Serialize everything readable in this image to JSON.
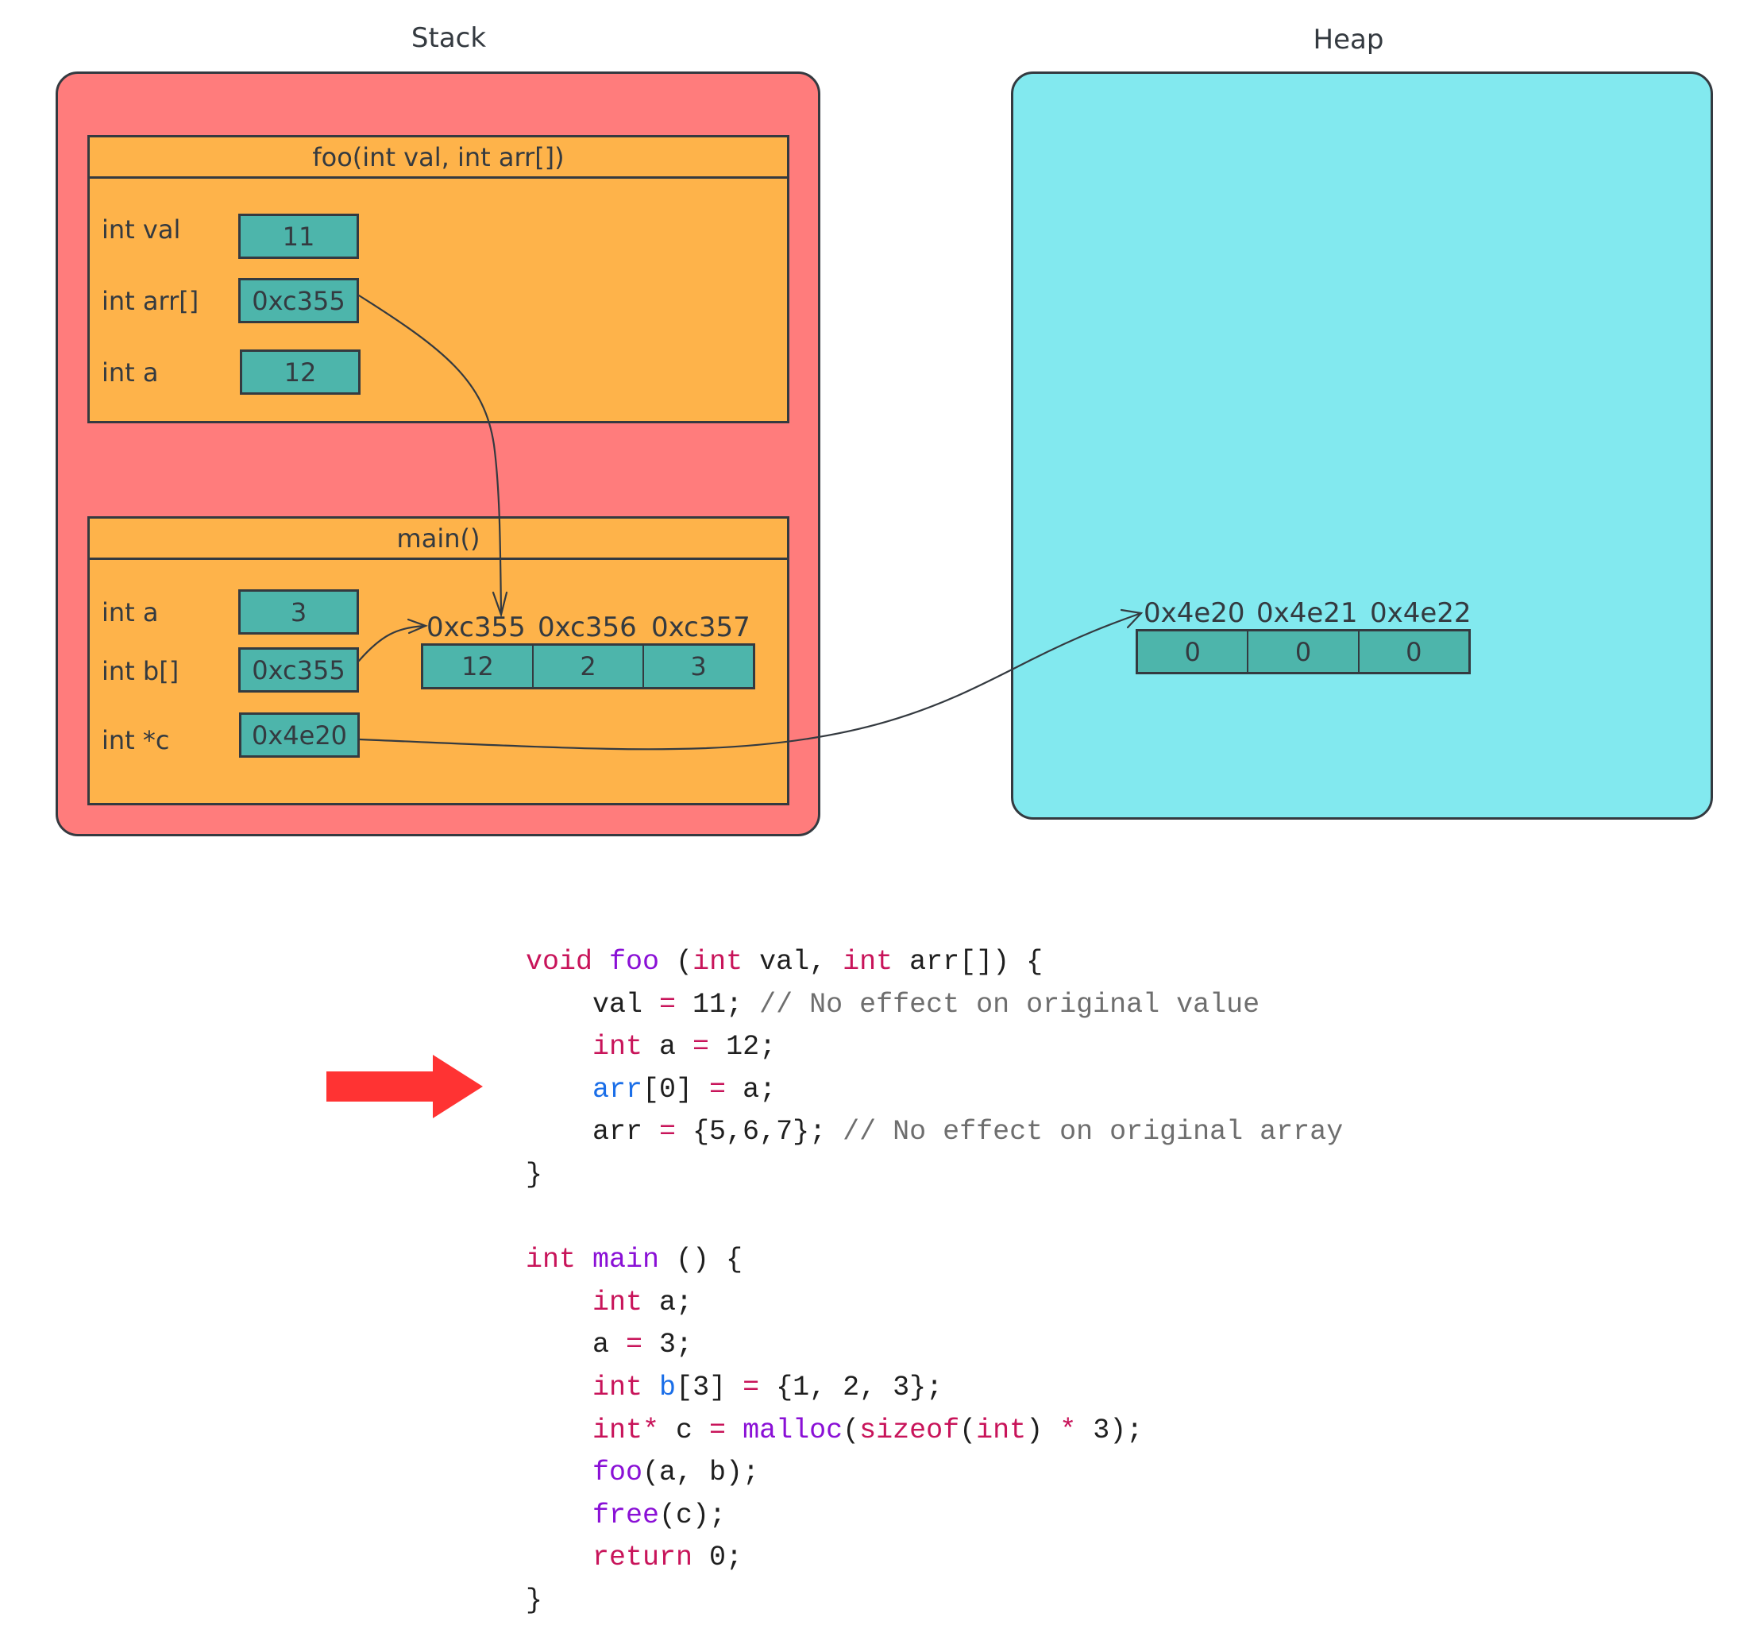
{
  "titles": {
    "stack": "Stack",
    "heap": "Heap"
  },
  "colors": {
    "stack_bg": "#ff7c7c",
    "heap_bg": "#82e9ef",
    "frame_bg": "#feb34a",
    "cell_bg": "#4db5ab",
    "stroke": "#343a40",
    "pointer_arrow": "#ff3333",
    "keyword": "#c8145a",
    "function": "#8a10d6",
    "variable_highlight": "#1a6ee8",
    "comment": "#6e6e6e"
  },
  "stack": {
    "frames": [
      {
        "header": "foo(int val, int arr[])",
        "vars": [
          {
            "label": "int val",
            "value": "11"
          },
          {
            "label": "int arr[]",
            "value": "0xc355"
          },
          {
            "label": "int a",
            "value": "12"
          }
        ]
      },
      {
        "header": "main()",
        "vars": [
          {
            "label": "int a",
            "value": "3"
          },
          {
            "label": "int b[]",
            "value": "0xc355"
          },
          {
            "label": "int *c",
            "value": "0x4e20"
          }
        ],
        "array": {
          "addresses": [
            "0xc355",
            "0xc356",
            "0xc357"
          ],
          "values": [
            "12",
            "2",
            "3"
          ]
        }
      }
    ]
  },
  "heap": {
    "array": {
      "addresses": [
        "0x4e20",
        "0x4e21",
        "0x4e22"
      ],
      "values": [
        "0",
        "0",
        "0"
      ]
    }
  },
  "pointers": [
    {
      "from": "foo.arr",
      "to": "main.b[0] (0xc355)"
    },
    {
      "from": "main.b",
      "to": "main.b[0] (0xc355)"
    },
    {
      "from": "main.c",
      "to": "heap[0] (0x4e20)"
    }
  ],
  "current_line_indicator": {
    "icon": "right-arrow-icon",
    "line_index": 3
  },
  "code": {
    "lines": [
      [
        [
          "kw",
          "void"
        ],
        [
          "t",
          " "
        ],
        [
          "fn",
          "foo"
        ],
        [
          "t",
          " ("
        ],
        [
          "kw",
          "int"
        ],
        [
          "t",
          " val, "
        ],
        [
          "kw",
          "int"
        ],
        [
          "t",
          " arr[]) {"
        ]
      ],
      [
        [
          "t",
          "    val "
        ],
        [
          "op",
          "="
        ],
        [
          "t",
          " 11; "
        ],
        [
          "cm",
          "// No effect on original value"
        ]
      ],
      [
        [
          "t",
          "    "
        ],
        [
          "kw",
          "int"
        ],
        [
          "t",
          " a "
        ],
        [
          "op",
          "="
        ],
        [
          "t",
          " 12;"
        ]
      ],
      [
        [
          "t",
          "    "
        ],
        [
          "vr",
          "arr"
        ],
        [
          "t",
          "[0] "
        ],
        [
          "op",
          "="
        ],
        [
          "t",
          " a;"
        ]
      ],
      [
        [
          "t",
          "    arr "
        ],
        [
          "op",
          "="
        ],
        [
          "t",
          " {5,6,7}; "
        ],
        [
          "cm",
          "// No effect on original array"
        ]
      ],
      [
        [
          "t",
          "}"
        ]
      ],
      [
        [
          "t",
          ""
        ]
      ],
      [
        [
          "kw",
          "int"
        ],
        [
          "t",
          " "
        ],
        [
          "fn",
          "main"
        ],
        [
          "t",
          " () {"
        ]
      ],
      [
        [
          "t",
          "    "
        ],
        [
          "kw",
          "int"
        ],
        [
          "t",
          " a;"
        ]
      ],
      [
        [
          "t",
          "    a "
        ],
        [
          "op",
          "="
        ],
        [
          "t",
          " 3;"
        ]
      ],
      [
        [
          "t",
          "    "
        ],
        [
          "kw",
          "int"
        ],
        [
          "t",
          " "
        ],
        [
          "vr",
          "b"
        ],
        [
          "t",
          "[3] "
        ],
        [
          "op",
          "="
        ],
        [
          "t",
          " {1, 2, 3};"
        ]
      ],
      [
        [
          "t",
          "    "
        ],
        [
          "kw",
          "int*"
        ],
        [
          "t",
          " c "
        ],
        [
          "op",
          "="
        ],
        [
          "t",
          " "
        ],
        [
          "fn",
          "malloc"
        ],
        [
          "t",
          "("
        ],
        [
          "kw",
          "sizeof"
        ],
        [
          "t",
          "("
        ],
        [
          "kw",
          "int"
        ],
        [
          "t",
          ") "
        ],
        [
          "op",
          "*"
        ],
        [
          "t",
          " 3);"
        ]
      ],
      [
        [
          "t",
          "    "
        ],
        [
          "fn",
          "foo"
        ],
        [
          "t",
          "(a, b);"
        ]
      ],
      [
        [
          "t",
          "    "
        ],
        [
          "fn",
          "free"
        ],
        [
          "t",
          "(c);"
        ]
      ],
      [
        [
          "t",
          "    "
        ],
        [
          "kw",
          "return"
        ],
        [
          "t",
          " 0;"
        ]
      ],
      [
        [
          "t",
          "}"
        ]
      ]
    ]
  }
}
